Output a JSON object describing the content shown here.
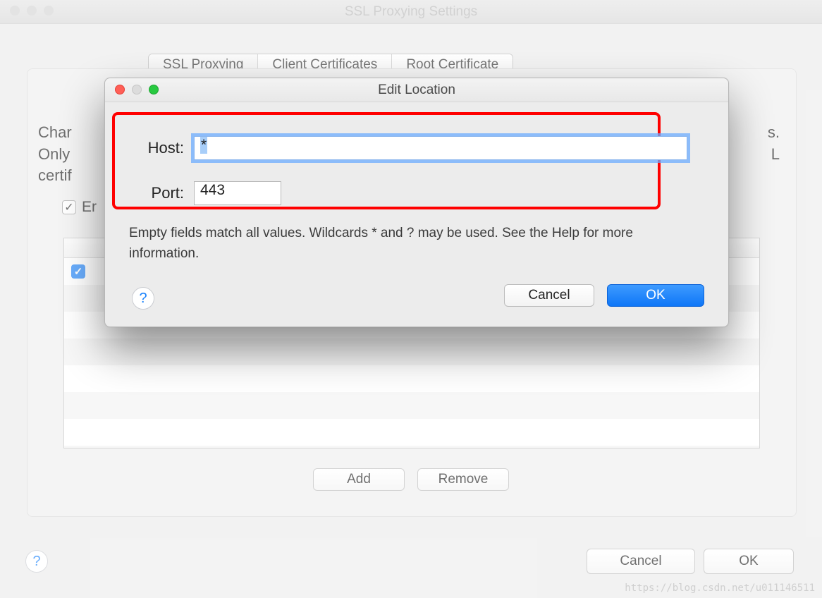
{
  "back_window": {
    "title": "SSL Proxying Settings",
    "tabs": [
      "SSL Proxying",
      "Client Certificates",
      "Root Certificate"
    ],
    "active_tab_index": 0,
    "desc_left": [
      "Char",
      "Only",
      "certif"
    ],
    "desc_right": [
      "s.",
      "L"
    ],
    "enable_label_fragment": "Er",
    "enable_checked": true,
    "row0_checked": true,
    "add_label": "Add",
    "remove_label": "Remove",
    "cancel_label": "Cancel",
    "ok_label": "OK"
  },
  "modal": {
    "title": "Edit Location",
    "host_label": "Host:",
    "host_value": "*",
    "port_label": "Port:",
    "port_value": "443",
    "hint": "Empty fields match all values. Wildcards * and ? may be used. See the Help for more information.",
    "cancel_label": "Cancel",
    "ok_label": "OK"
  },
  "watermark": "https://blog.csdn.net/u011146511"
}
